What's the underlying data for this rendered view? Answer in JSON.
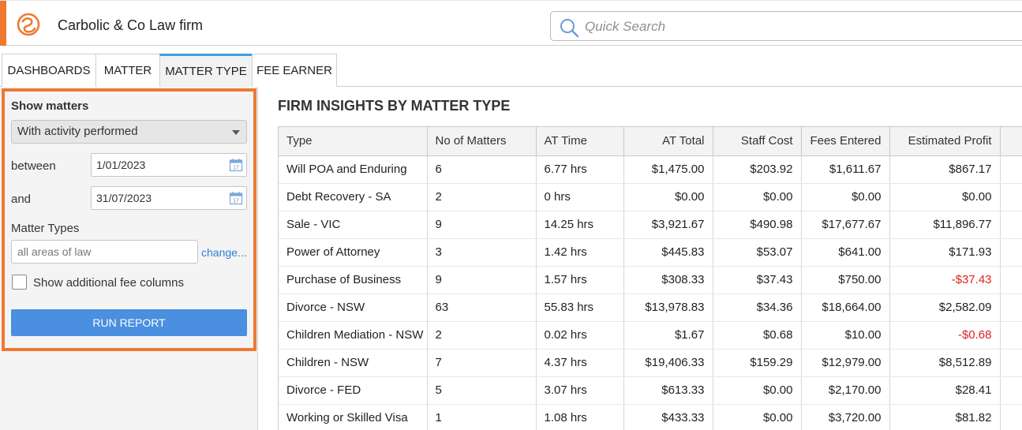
{
  "header": {
    "app_title": "Carbolic & Co Law firm",
    "search_placeholder": "Quick Search",
    "accent_color": "#ee7a31"
  },
  "tabs": [
    {
      "label": "DASHBOARDS",
      "active": false
    },
    {
      "label": "MATTER",
      "active": false
    },
    {
      "label": "MATTER TYPE",
      "active": true
    },
    {
      "label": "FEE EARNER",
      "active": false
    }
  ],
  "filters": {
    "show_matters_label": "Show matters",
    "show_matters_value": "With activity performed",
    "between_label": "between",
    "between_value": "1/01/2023",
    "and_label": "and",
    "and_value": "31/07/2023",
    "matter_types_label": "Matter Types",
    "matter_types_value": "all areas of law",
    "change_link": "change...",
    "additional_fee_label": "Show additional fee columns",
    "additional_fee_checked": false,
    "run_report_label": "RUN REPORT"
  },
  "main": {
    "title": "FIRM INSIGHTS BY MATTER TYPE",
    "columns": [
      "Type",
      "No of Matters",
      "AT Time",
      "AT Total",
      "Staff Cost",
      "Fees Entered",
      "Estimated Profit"
    ],
    "rows": [
      [
        "Will POA and Enduring",
        "6",
        "6.77 hrs",
        "$1,475.00",
        "$203.92",
        "$1,611.67",
        "$867.17"
      ],
      [
        "Debt Recovery - SA",
        "2",
        "0 hrs",
        "$0.00",
        "$0.00",
        "$0.00",
        "$0.00"
      ],
      [
        "Sale - VIC",
        "9",
        "14.25 hrs",
        "$3,921.67",
        "$490.98",
        "$17,677.67",
        "$11,896.77"
      ],
      [
        "Power of Attorney",
        "3",
        "1.42 hrs",
        "$445.83",
        "$53.07",
        "$641.00",
        "$171.93"
      ],
      [
        "Purchase of Business",
        "9",
        "1.57 hrs",
        "$308.33",
        "$37.43",
        "$750.00",
        "-$37.43"
      ],
      [
        "Divorce - NSW",
        "63",
        "55.83 hrs",
        "$13,978.83",
        "$34.36",
        "$18,664.00",
        "$2,582.09"
      ],
      [
        "Children Mediation - NSW",
        "2",
        "0.02 hrs",
        "$1.67",
        "$0.68",
        "$10.00",
        "-$0.68"
      ],
      [
        "Children - NSW",
        "7",
        "4.37 hrs",
        "$19,406.33",
        "$159.29",
        "$12,979.00",
        "$8,512.89"
      ],
      [
        "Divorce - FED",
        "5",
        "3.07 hrs",
        "$613.33",
        "$0.00",
        "$2,170.00",
        "$28.41"
      ],
      [
        "Working or Skilled Visa",
        "1",
        "1.08 hrs",
        "$433.33",
        "$0.00",
        "$3,720.00",
        "$81.82"
      ]
    ]
  }
}
